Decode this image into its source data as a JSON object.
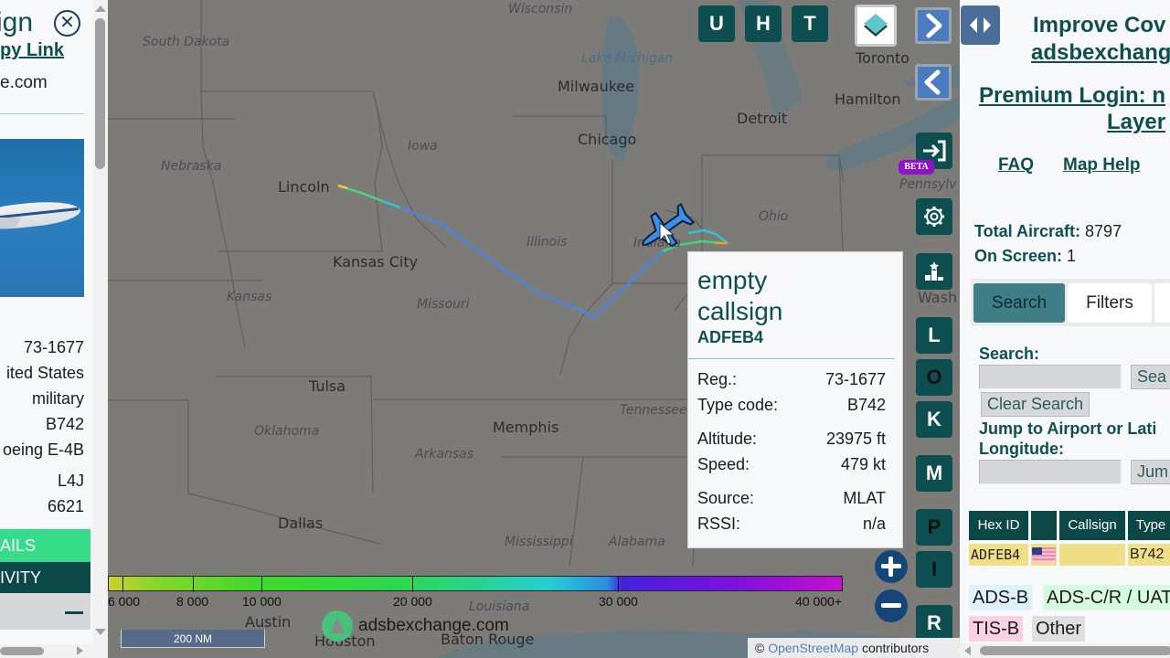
{
  "left_panel": {
    "title_partial": "ign",
    "copy_link_partial": "py Link",
    "site_partial": "e.com",
    "details": [
      "73-1677",
      "ited States",
      "military",
      "B742",
      "oeing E-4B",
      "L4J",
      "6621"
    ],
    "buttons": {
      "details_partial": "AILS",
      "activity_partial": "IVITY"
    }
  },
  "map": {
    "cities": [
      "Lincoln",
      "Kansas City",
      "Milwaukee",
      "Chicago",
      "Detroit",
      "Toronto",
      "Hamilton",
      "Tulsa",
      "Memphis",
      "Dallas",
      "Austin",
      "Houston",
      "Baton Rouge"
    ],
    "states": [
      "South Dakota",
      "Nebraska",
      "Iowa",
      "Kansas",
      "Illinois",
      "Indiana",
      "Ohio",
      "Missouri",
      "Oklahoma",
      "Arkansas",
      "Tennessee",
      "Mississippi",
      "Alabama",
      "Wisconsin",
      "Pennsylv",
      "Louisiana",
      "Wash"
    ],
    "water": [
      "Lake Michigan"
    ],
    "top_buttons": [
      "U",
      "H",
      "T"
    ],
    "side_buttons": [
      "L",
      "O",
      "K",
      "M",
      "P",
      "I",
      "R"
    ],
    "beta_badge": "BETA",
    "altitude_legend": {
      "labels": [
        "6 000",
        "8 000",
        "10 000",
        "20 000",
        "30 000",
        "40 000+"
      ],
      "colors": {
        "low": "#c9d22a",
        "mid": "#26cfd3",
        "high": "#c80fcf"
      }
    },
    "scale_label": "200 NM",
    "brand": "adsbexchange.com",
    "attribution": {
      "symbol": "©",
      "link": "OpenStreetMap",
      "text": "contributors"
    },
    "track_color": "#4a86e0",
    "aircraft_color": "#3d8ee8"
  },
  "popup": {
    "callsign_line1": "empty",
    "callsign_line2": "callsign",
    "hex": "ADFEB4",
    "rows": [
      {
        "label": "Reg.:",
        "value": "73-1677"
      },
      {
        "label": "Type code:",
        "value": "B742"
      },
      {
        "label": "Altitude:",
        "value": "23975 ft"
      },
      {
        "label": "Speed:",
        "value": "479 kt"
      },
      {
        "label": "Source:",
        "value": "MLAT"
      },
      {
        "label": "RSSI:",
        "value": "n/a"
      }
    ]
  },
  "right_panel": {
    "improve_coverage": "Improve Cov",
    "adsbx_link": "adsbexchang",
    "premium_login": "Premium Login: n",
    "premium_login_2": "Layer",
    "faq": "FAQ",
    "map_help": "Map Help",
    "total_aircraft_label": "Total Aircraft:",
    "total_aircraft": "8797",
    "on_screen_label": "On Screen:",
    "on_screen": "1",
    "tabs": [
      "Search",
      "Filters"
    ],
    "active_tab": "Search",
    "search_label": "Search:",
    "search_value": "",
    "search_button": "Sea",
    "clear_search": "Clear Search",
    "jump_label_1": "Jump to Airport or Lati",
    "jump_label_2": "Longitude:",
    "jump_value": "",
    "jump_button": "Jum",
    "table": {
      "headers": [
        "Hex ID",
        "",
        "Callsign",
        "Type"
      ],
      "rows": [
        {
          "hex": "ADFEB4",
          "flag": "us-flag",
          "callsign": "",
          "type": "B742"
        }
      ]
    },
    "source_legend": [
      {
        "label": "ADS-B",
        "color": "#dff1fb"
      },
      {
        "label": "ADS-C/R / UAT",
        "color": "#d7fbe0"
      },
      {
        "label": "TIS-B",
        "color": "#f9d1e0"
      },
      {
        "label": "Other",
        "color": "#dedede"
      }
    ]
  }
}
